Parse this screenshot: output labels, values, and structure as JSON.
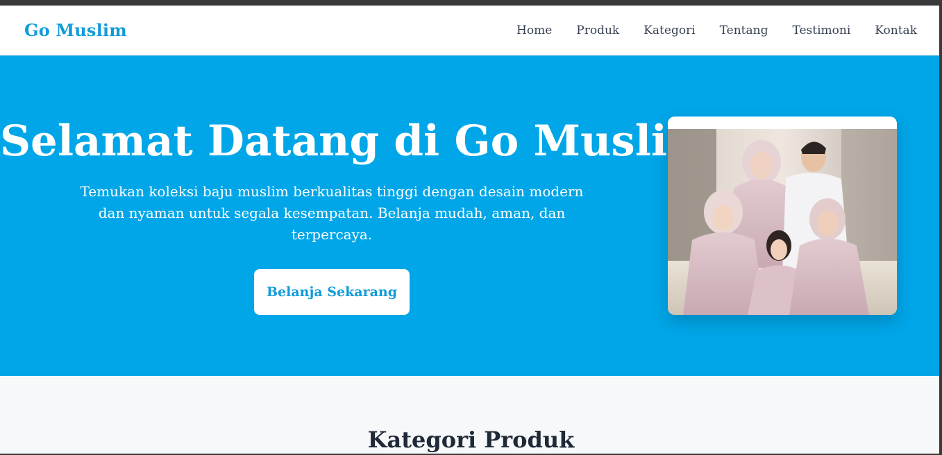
{
  "navbar": {
    "brand": "Go Muslim",
    "links": [
      "Home",
      "Produk",
      "Kategori",
      "Tentang",
      "Testimoni",
      "Kontak"
    ]
  },
  "hero": {
    "title": "Selamat Datang di Go Muslim",
    "subtitle": "Temukan koleksi baju muslim berkualitas tinggi dengan desain modern dan nyaman untuk segala kesempatan. Belanja mudah, aman, dan terpercaya.",
    "cta_label": "Belanja Sekarang",
    "image": "family-photo"
  },
  "categories": {
    "title": "Kategori Produk"
  },
  "colors": {
    "primary": "#00a6e8",
    "brand_text": "#0f9bd9",
    "nav_text": "#374151",
    "section_bg": "#f7f8fa"
  }
}
